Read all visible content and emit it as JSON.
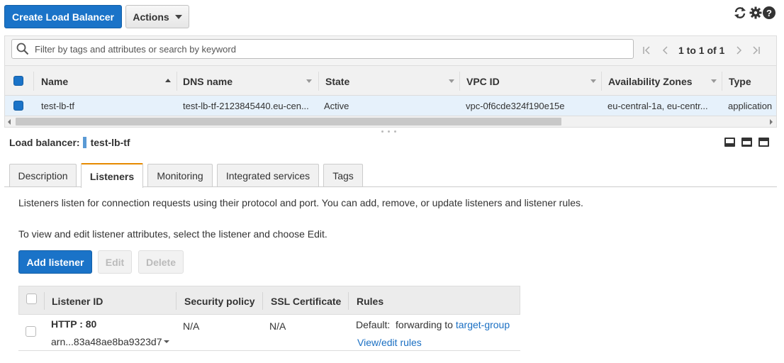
{
  "toolbar": {
    "create_label": "Create Load Balancer",
    "actions_label": "Actions"
  },
  "header_icons": [
    "refresh-icon",
    "gear-icon",
    "help-icon"
  ],
  "search": {
    "placeholder": "Filter by tags and attributes or search by keyword"
  },
  "pagination": {
    "text": "1 to 1 of 1"
  },
  "grid": {
    "columns": [
      "Name",
      "DNS name",
      "State",
      "VPC ID",
      "Availability Zones",
      "Type"
    ],
    "rows": [
      {
        "name": "test-lb-tf",
        "dns": "test-lb-tf-2123845440.eu-cen...",
        "state": "Active",
        "vpc": "vpc-0f6cde324f190e15e",
        "az": "eu-central-1a, eu-centr...",
        "type": "application"
      }
    ]
  },
  "detail": {
    "label": "Load balancer:",
    "name": "test-lb-tf"
  },
  "tabs": [
    "Description",
    "Listeners",
    "Monitoring",
    "Integrated services",
    "Tags"
  ],
  "active_tab": "Listeners",
  "listeners": {
    "intro": "Listeners listen for connection requests using their protocol and port. You can add, remove, or update listeners and listener rules.",
    "edit_hint": "To view and edit listener attributes, select the listener and choose Edit.",
    "add_label": "Add listener",
    "edit_label": "Edit",
    "delete_label": "Delete",
    "columns": [
      "Listener ID",
      "Security policy",
      "SSL Certificate",
      "Rules"
    ],
    "rows": [
      {
        "id": "HTTP : 80",
        "arn": "arn...83a48ae8ba9323d7",
        "security_policy": "N/A",
        "ssl_certificate": "N/A",
        "rule_prefix": "Default:  forwarding to",
        "rule_target": "target-group",
        "rule_link": "View/edit rules"
      }
    ]
  },
  "colors": {
    "primary": "#1a73c8",
    "active_tab_accent": "#e68a00",
    "link": "#1a6fc3",
    "row_selected": "#e6f1fb"
  }
}
